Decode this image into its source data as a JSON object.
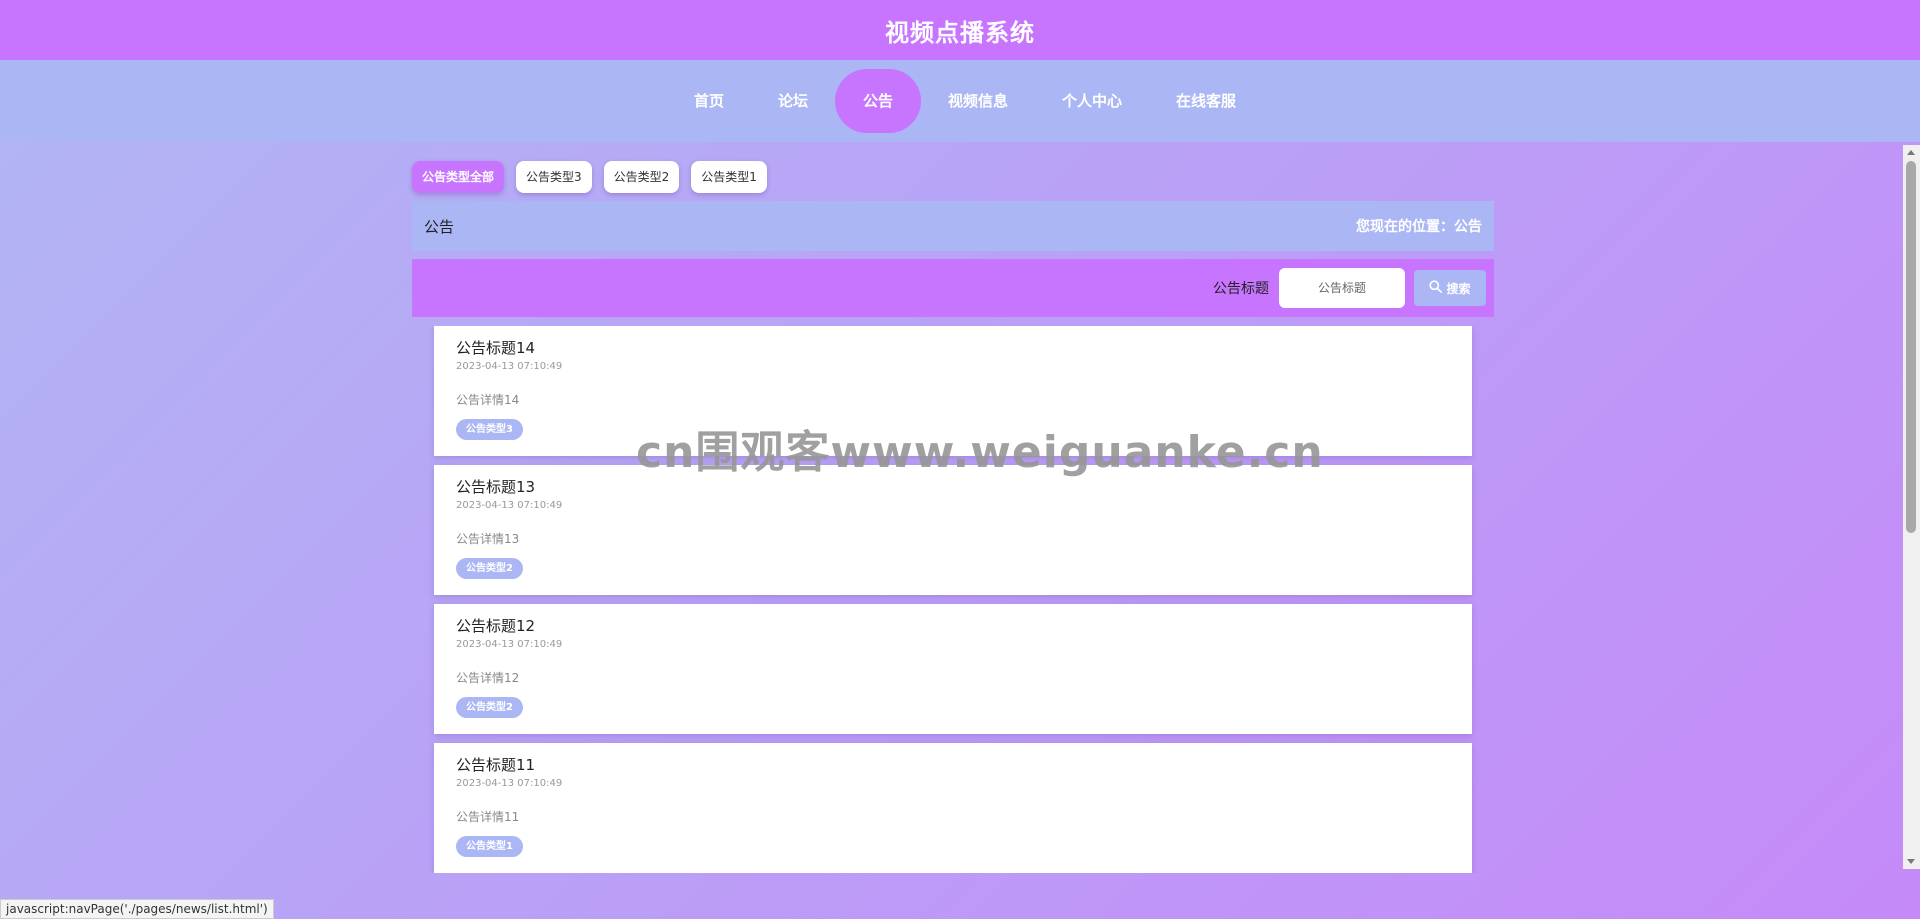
{
  "site": {
    "title": "视频点播系统"
  },
  "nav": {
    "items": [
      {
        "label": "首页"
      },
      {
        "label": "论坛"
      },
      {
        "label": "公告"
      },
      {
        "label": "视频信息"
      },
      {
        "label": "个人中心"
      },
      {
        "label": "在线客服"
      }
    ],
    "active_index": 2
  },
  "type_filters": [
    {
      "label": "公告类型全部"
    },
    {
      "label": "公告类型3"
    },
    {
      "label": "公告类型2"
    },
    {
      "label": "公告类型1"
    }
  ],
  "breadcrumb": {
    "title": "公告",
    "location": "您现在的位置：公告"
  },
  "search": {
    "label": "公告标题",
    "placeholder": "公告标题",
    "button_label": "搜索"
  },
  "news": [
    {
      "title": "公告标题14",
      "time": "2023-04-13 07:10:49",
      "desc": "公告详情14",
      "tag": "公告类型3"
    },
    {
      "title": "公告标题13",
      "time": "2023-04-13 07:10:49",
      "desc": "公告详情13",
      "tag": "公告类型2"
    },
    {
      "title": "公告标题12",
      "time": "2023-04-13 07:10:49",
      "desc": "公告详情12",
      "tag": "公告类型2"
    },
    {
      "title": "公告标题11",
      "time": "2023-04-13 07:10:49",
      "desc": "公告详情11",
      "tag": "公告类型1"
    }
  ],
  "watermark": "cn围观客www.weiguanke.cn",
  "status_bar": {
    "url": "javascript:navPage('./pages/news/list.html')"
  },
  "colors": {
    "primary": "#c774fe",
    "secondary": "#abb7f4"
  }
}
